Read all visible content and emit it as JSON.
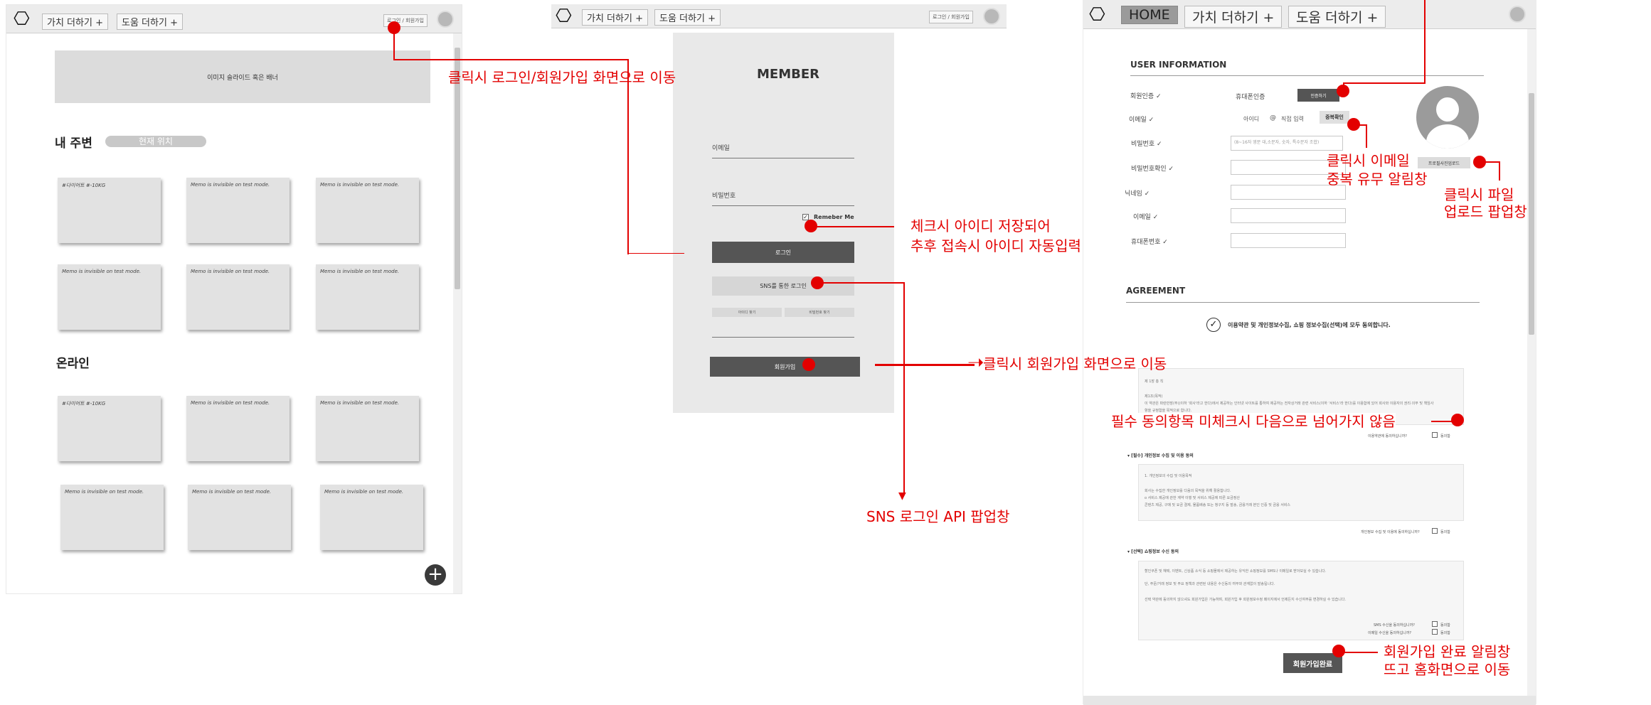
{
  "screen1": {
    "nav": {
      "add_value": "가치 더하기 +",
      "add_help": "도움 더하기 +",
      "login_signup": "로그인 / 회원가입"
    },
    "banner": "이미지 슬라이드 혹은 배너",
    "nearby": {
      "title": "내 주변",
      "location_pill": "현재 위치"
    },
    "online": {
      "title": "온라인"
    },
    "cards_nearby": [
      "#다이어트 #-10KG",
      "Memo is invisible on test mode.",
      "Memo is invisible on test mode.",
      "Memo is invisible on test mode.",
      "Memo is invisible on test mode.",
      "Memo is invisible on test mode."
    ],
    "cards_online": [
      "#다이어트 #-10KG",
      "Memo is invisible on test mode.",
      "Memo is invisible on test mode.",
      "Memo is invisible on test mode.",
      "Memo is invisible on test mode.",
      "Memo is invisible on test mode."
    ],
    "fab": "+"
  },
  "screen2": {
    "nav": {
      "add_value": "가치 더하기 +",
      "add_help": "도움 더하기 +",
      "login_signup": "로그인 / 회원가입"
    },
    "title": "MEMBER",
    "email_label": "이메일",
    "password_label": "비밀번호",
    "remember": "Remeber Me",
    "remember_check": "✓",
    "login_btn": "로그인",
    "sns_btn": "SNS를 통한 로그인",
    "find_id": "아이디 찾기",
    "find_pw": "비밀번호 찾기",
    "signup_btn": "회원가입"
  },
  "screen3": {
    "nav": {
      "home": "HOME",
      "add_value": "가치 더하기 +",
      "add_help": "도움 더하기 +"
    },
    "user_info_title": "USER INFORMATION",
    "fields": {
      "auth": "회원인증 ✓",
      "auth_phone": "휴대폰인증",
      "auth_btn": "인증하기",
      "email": "이메일 ✓",
      "email_id": "아이디",
      "email_at": "@",
      "email_direct": "직접 입력",
      "dup_check": "중복확인",
      "password": "비밀번호 ✓",
      "password_hint": "(8~16자 영문 대,소문자, 숫자, 특수문자 조합)",
      "password_confirm": "비밀번호확인 ✓",
      "nickname": "닉네임 ✓",
      "email2": "이메일 ✓",
      "phone": "휴대폰번호 ✓",
      "photo_btn": "프로필사진업로드"
    },
    "agreement_title": "AGREEMENT",
    "agree_all_check": "✓",
    "agree_all": "이용약관 및 개인정보수집, 쇼핑 정보수집(선택)에 모두 동의합니다.",
    "terms": {
      "chapter": "제 1장 총 칙",
      "article": "제1조(목적)",
      "body1": "이 약관은 파란만장(주)(이하 '회사'라고 한다)에서 제공하는 인터넷 사이트를 통하여 제공하는 전자상거래 관련 서비스(이하 '서비스'라 한다)를 이용함에 있어 회사와 이용자의 권리·의무 및 책임사",
      "body2": "항을 규정함을 목적으로 합니다.",
      "agree_q": "이용약관에 동의하십니까?",
      "agree": "동의함"
    },
    "privacy": {
      "title": "▾  [필수] 개인정보 수집 및 이용 동의",
      "l1": "1. 개인정보의 수집 및 이용목적",
      "l2": "회사는 수집한 개인정보를 다음의 목적을 위해 활용합니다.",
      "l3": "o 서비스 제공에 관한 계약 이행 및 서비스 제공에 따른 요금정산",
      "l4": "콘텐츠 제공, 구매 및 요금 결제, 물품배송 또는 청구지 등 발송, 금융거래 본인 인증 및 금융 서비스",
      "agree_q": "개인정보 수집 및 이용에 동의하십니까?",
      "agree": "동의함"
    },
    "shopping": {
      "title": "▾  [선택] 쇼핑정보 수신 동의",
      "l1": "할인쿠폰 및 혜택, 이벤트, 신상품 소식 등 쇼핑몰에서 제공하는 유익한 쇼핑정보를 SMS나 이메일로 받아보실 수 있습니다.",
      "l2": "단, 주문/거래 정보 및 주요 정책과 관련된 내용은 수신동의 여부와 관계없이 발송됩니다.",
      "l3": "선택 약관에 동의하지 않으셔도 회원가입은 가능하며, 회원가입 후 회원정보수정 페이지에서 언제든지 수신여부를 변경하실 수 있습니다.",
      "sms_q": "SMS 수신을 동의하십니까?",
      "email_q": "이메일 수신을 동의하십니까?",
      "agree": "동의함"
    },
    "complete_btn": "회원가입완료"
  },
  "annotations": {
    "a1": "클릭시 로그인/회원가입 화면으로 이동",
    "a2_l1": "체크시 아이디 저장되어",
    "a2_l2": "추후 접속시 아이디 자동입력",
    "a3": "클릭시 회원가입 화면으로 이동",
    "a4": "SNS 로그인 API 팝업창",
    "a5_l1": "클릭시 이메일",
    "a5_l2": "중복 유무 알림창",
    "a6_l1": "클릭시 파일",
    "a6_l2": "업로드 팝업창",
    "a7": "필수 동의항목 미체크시 다음으로 넘어가지 않음",
    "a8_l1": "회원가입 완료 알림창",
    "a8_l2": "뜨고 홈화면으로 이동"
  },
  "colors": {
    "accent_red": "#e30000",
    "bar_gray": "#ececec",
    "card_gray": "#e2e2e2"
  }
}
